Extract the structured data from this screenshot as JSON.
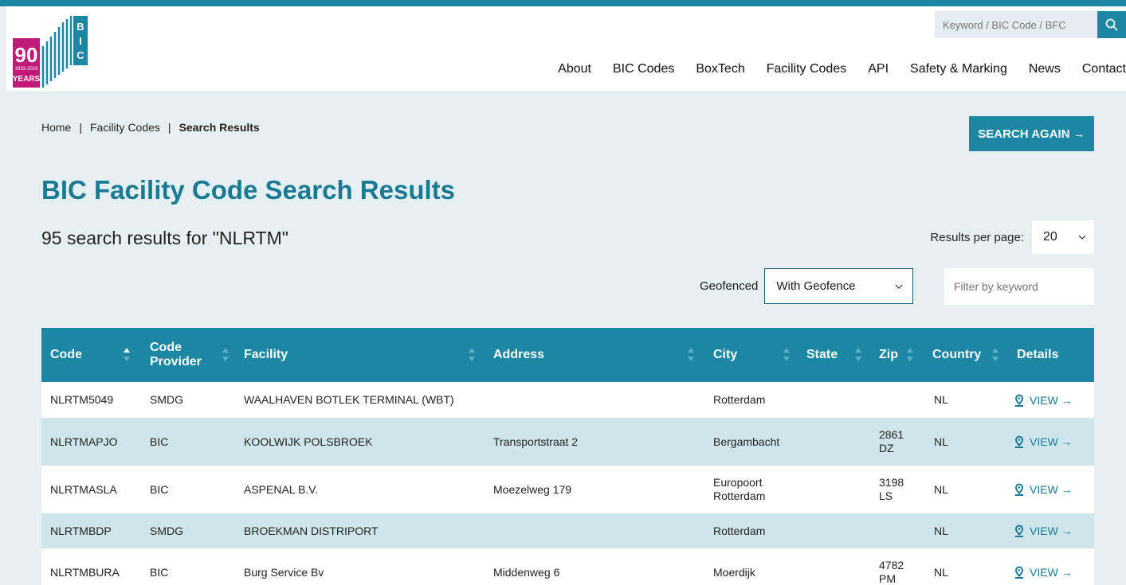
{
  "logo": {
    "big_number": "90",
    "years_label": "YEARS",
    "date_range": "1933-2023",
    "brand": "BIC"
  },
  "search": {
    "placeholder": "Keyword / BIC Code / BFC",
    "icon": "search-icon"
  },
  "nav": [
    "About",
    "BIC Codes",
    "BoxTech",
    "Facility Codes",
    "API",
    "Safety & Marking",
    "News",
    "Contact"
  ],
  "breadcrumb": {
    "home": "Home",
    "sep": "|",
    "section": "Facility Codes",
    "current": "Search Results"
  },
  "search_again": "SEARCH AGAIN →",
  "page_title": "BIC Facility Code Search Results",
  "results_count": "95 search results for \"NLRTM\"",
  "results_per_page": {
    "label": "Results per page:",
    "value": "20"
  },
  "geofence": {
    "label": "Geofenced",
    "value": "With Geofence"
  },
  "filter": {
    "placeholder": "Filter by keyword"
  },
  "table": {
    "headers": [
      "Code",
      "Code Provider",
      "Facility",
      "Address",
      "City",
      "State",
      "Zip",
      "Country",
      "Details"
    ],
    "rows": [
      {
        "code": "NLRTM5049",
        "provider": "SMDG",
        "facility": "WAALHAVEN BOTLEK TERMINAL (WBT)",
        "address": "",
        "city": "Rotterdam",
        "state": "",
        "zip": "",
        "country": "NL",
        "details": "VIEW →"
      },
      {
        "code": "NLRTMAPJO",
        "provider": "BIC",
        "facility": "KOOLWIJK POLSBROEK",
        "address": "Transportstraat 2",
        "city": "Bergambacht",
        "state": "",
        "zip": "2861 DZ",
        "country": "NL",
        "details": "VIEW →"
      },
      {
        "code": "NLRTMASLA",
        "provider": "BIC",
        "facility": "ASPENAL B.V.",
        "address": "Moezelweg 179",
        "city": "Europoort Rotterdam",
        "state": "",
        "zip": "3198 LS",
        "country": "NL",
        "details": "VIEW →"
      },
      {
        "code": "NLRTMBDP",
        "provider": "SMDG",
        "facility": "BROEKMAN DISTRIPORT",
        "address": "",
        "city": "Rotterdam",
        "state": "",
        "zip": "",
        "country": "NL",
        "details": "VIEW →"
      },
      {
        "code": "NLRTMBURA",
        "provider": "BIC",
        "facility": "Burg Service Bv",
        "address": "Middenweg 6",
        "city": "Moerdijk",
        "state": "",
        "zip": "4782 PM",
        "country": "NL",
        "details": "VIEW →"
      }
    ]
  },
  "colors": {
    "accent": "#1b87a3",
    "title": "#1b7a93",
    "row_alt": "#cfe5ec",
    "logo_pink": "#c2187a"
  }
}
